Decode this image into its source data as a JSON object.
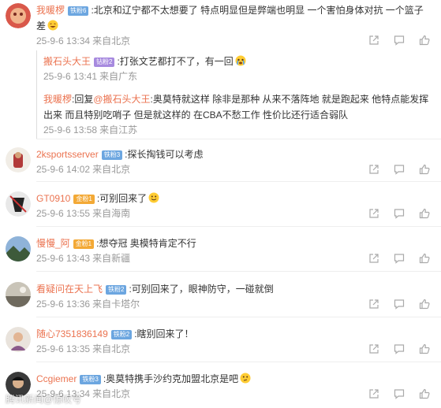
{
  "comments": [
    {
      "user": "我暖椤",
      "badge": "铁粉6",
      "text": ":北京和辽宁都不太想要了  特点明显但是弊端也明显  一个害怕身体对抗 一个篮子差",
      "time": "25-9-6 13:34",
      "location": "来自北京",
      "replies": [
        {
          "user": "搬石头大王",
          "badge": "钻粉2",
          "text": ":打张文艺都打不了，有一回",
          "time": "25-9-6 13:41",
          "location": "来自广东"
        },
        {
          "user": "我暖椤",
          "text_prefix": ":回复",
          "mention": "@搬石头大王",
          "text": ":奥莫特就这样 除非是那种 从来不落阵地 就是跑起来 他特点能发挥出来   而且特别吃哨子    但是就这样的 在CBA不愁工作 性价比还行适合弱队",
          "time": "25-9-6 13:58",
          "location": "来自江苏"
        }
      ]
    },
    {
      "user": "2ksportsserver",
      "badge": "铁粉3",
      "text": ":探长掏钱可以考虑",
      "time": "25-9-6 14:02",
      "location": "来自北京"
    },
    {
      "user": "GT0910",
      "badge": "金粉1",
      "text": ":可别回来了",
      "time": "25-9-6 13:55",
      "location": "来自海南"
    },
    {
      "user": "慢慢_阿",
      "badge": "金粉1",
      "text": ":想夺冠 奥模特肯定不行",
      "time": "25-9-6 13:43",
      "location": "来自新疆"
    },
    {
      "user": "看疑问在天上飞",
      "badge": "铁粉2",
      "text": ":可别回来了，眼神防守，一碰就倒",
      "time": "25-9-6 13:36",
      "location": "来自卡塔尔"
    },
    {
      "user": "随心7351836149",
      "badge": "铁粉2",
      "text": ":瞎别回来了！",
      "time": "25-9-6 13:35",
      "location": "来自北京"
    },
    {
      "user": "Ccgiemer",
      "badge": "铁粉3",
      "text": ":奥莫特携手沙约克加盟北京是吧",
      "time": "25-9-6 13:34",
      "location": "来自北京"
    }
  ],
  "watermark": "腾讯新闻@惊叹号",
  "colors": {
    "username": "#eb7350",
    "meta": "#999999",
    "text": "#333333"
  }
}
